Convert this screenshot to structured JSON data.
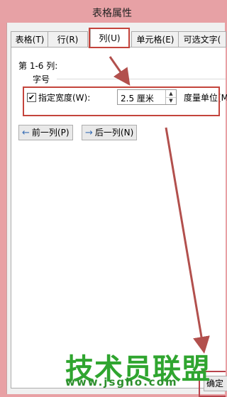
{
  "window": {
    "title": "表格属性"
  },
  "tabs": [
    {
      "label": "表格(T)"
    },
    {
      "label": "行(R)"
    },
    {
      "label": "列(U)"
    },
    {
      "label": "单元格(E)"
    },
    {
      "label": "可选文字("
    }
  ],
  "active_tab": "列(U)",
  "column_panel": {
    "range_label": "第 1-6 列:",
    "group_title": "字号",
    "preferred_width": {
      "checkbox_label": "指定宽度(W):",
      "checked": true,
      "checkmark": "✔",
      "value": "2.5 厘米",
      "spin_up": "▲",
      "spin_down": "▼",
      "unit_label": "度量单位(M):"
    },
    "prev_button": {
      "arrow": "←",
      "label": "前一列(P)"
    },
    "next_button": {
      "arrow": "→",
      "label": "后一列(N)"
    }
  },
  "footer": {
    "ok_label": "确定"
  },
  "watermark": {
    "brand": "技术员联盟",
    "url": "www.jsgho.com"
  },
  "colors": {
    "titlebar": "#e7a1a5",
    "highlight": "#c4443c",
    "annotation_arrow": "#b2504d",
    "watermark": "#2fa52f"
  }
}
